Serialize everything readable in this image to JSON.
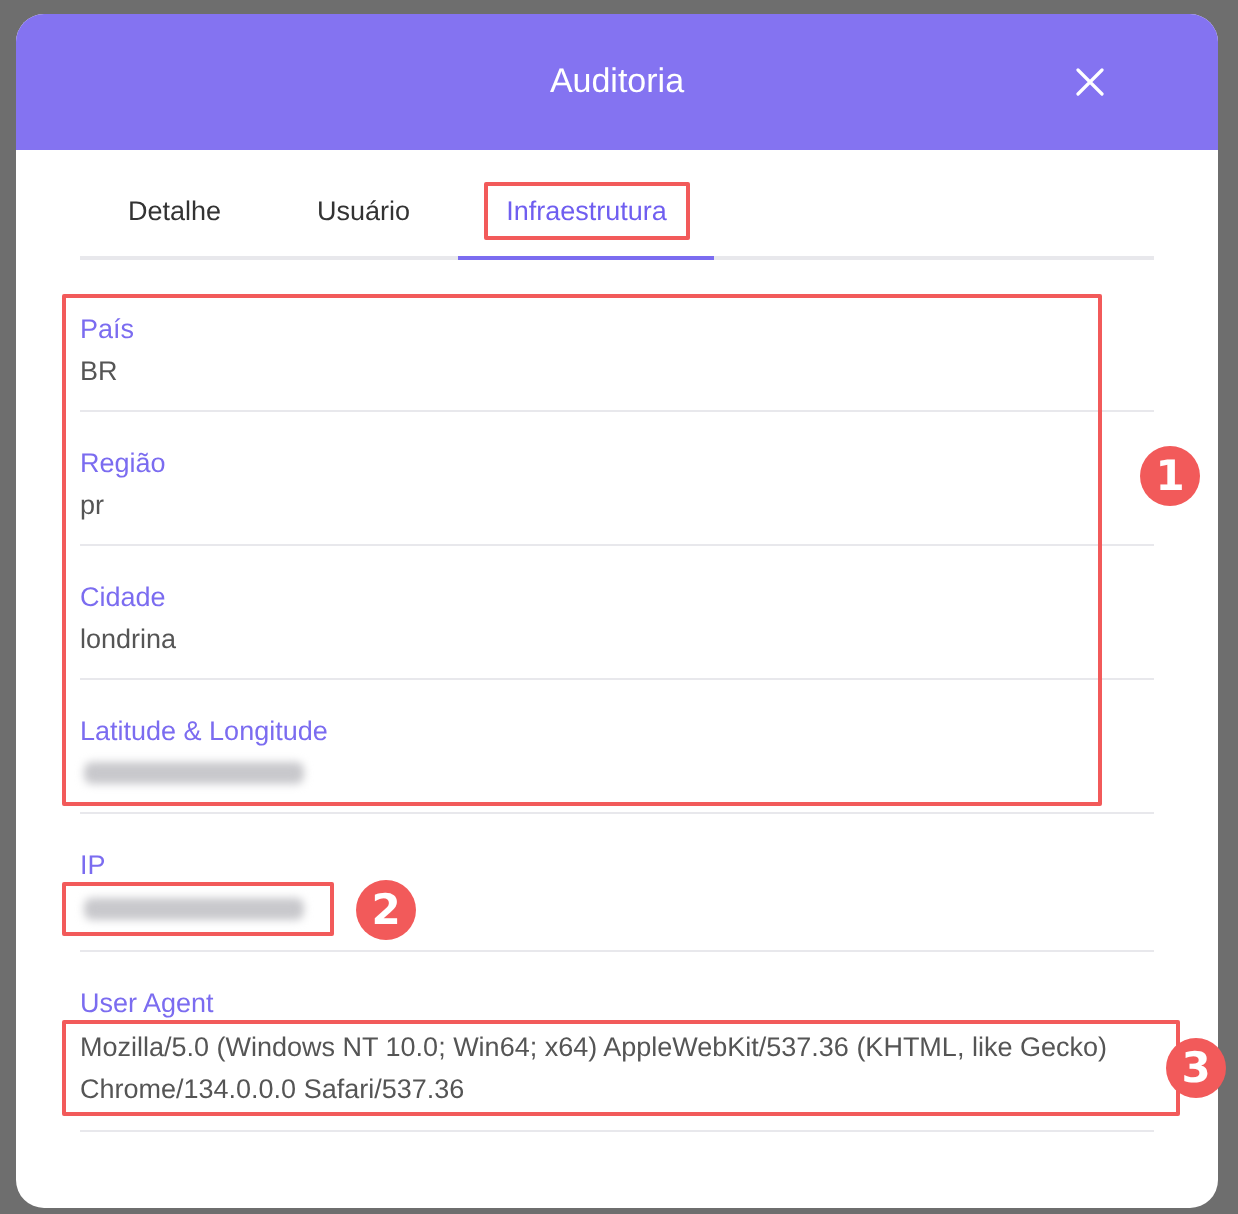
{
  "modal": {
    "title": "Auditoria"
  },
  "tabs": [
    {
      "label": "Detalhe",
      "selected": false,
      "boxed": false
    },
    {
      "label": "Usuário",
      "selected": false,
      "boxed": false
    },
    {
      "label": "Infraestrutura",
      "selected": true,
      "boxed": true
    }
  ],
  "groups": [
    {
      "marker": "1",
      "fields": [
        {
          "label": "País",
          "kind": "text",
          "value": "BR"
        },
        {
          "label": "Região",
          "kind": "text",
          "value": "pr"
        },
        {
          "label": "Cidade",
          "kind": "text",
          "value": "londrina"
        },
        {
          "label": "Latitude & Longitude",
          "kind": "blurred"
        }
      ]
    },
    {
      "fields": [
        {
          "label": "IP",
          "kind": "blurred",
          "marker": "2"
        }
      ]
    },
    {
      "fields": [
        {
          "label": "User Agent",
          "kind": "text",
          "value": "Mozilla/5.0 (Windows NT 10.0; Win64; x64) AppleWebKit/537.36 (KHTML, like Gecko) Chrome/134.0.0.0 Safari/537.36",
          "marker": "3"
        }
      ]
    }
  ]
}
